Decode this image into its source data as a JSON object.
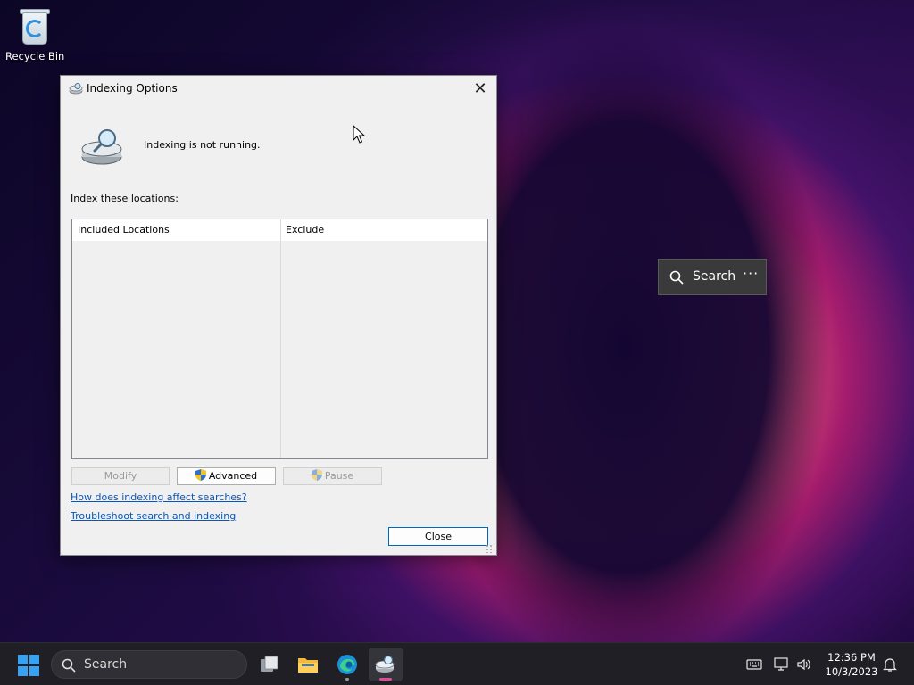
{
  "desktop": {
    "icons": [
      {
        "label": "Recycle Bin",
        "icon": "recycle-bin-icon"
      }
    ]
  },
  "dialog": {
    "title": "Indexing Options",
    "status": "Indexing is not running.",
    "index_label": "Index these locations:",
    "columns": [
      "Included Locations",
      "Exclude"
    ],
    "buttons": {
      "modify": "Modify",
      "advanced": "Advanced",
      "pause": "Pause",
      "close": "Close"
    },
    "links": {
      "how_affect": "How does indexing affect searches?",
      "troubleshoot": "Troubleshoot search and indexing"
    },
    "close_glyph": "✕"
  },
  "search_widget": {
    "label": "Search",
    "more": "···"
  },
  "taskbar": {
    "search_placeholder": "Search",
    "clock": {
      "time": "12:36 PM",
      "date": "10/3/2023"
    }
  },
  "colors": {
    "accent": "#0067c0",
    "link": "#0a56b8",
    "taskbar_bg": "#1f1f25"
  }
}
